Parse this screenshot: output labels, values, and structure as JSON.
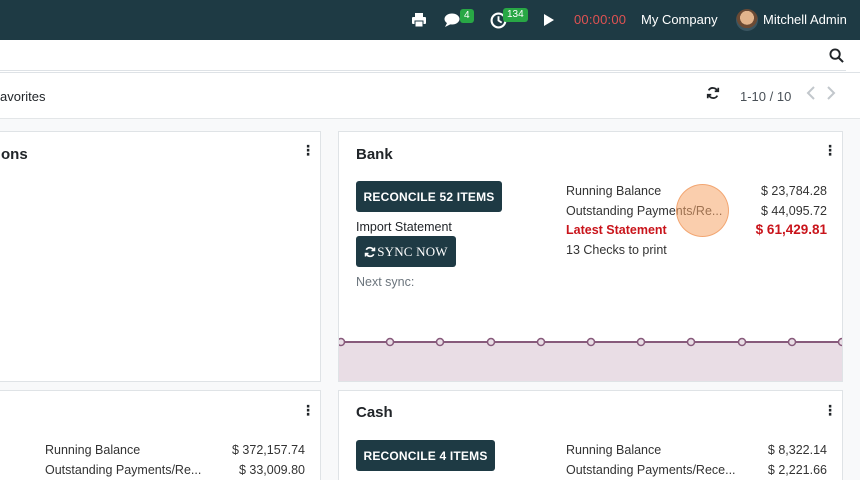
{
  "topnav": {
    "chat_badge": "4",
    "activity_badge": "134",
    "timer": "00:00:00",
    "company": "My Company",
    "user": "Mitchell Admin"
  },
  "control": {
    "favorites_label": "avorites",
    "pager": "1-10 / 10"
  },
  "cards": {
    "top_left": {
      "title": "ons"
    },
    "bank": {
      "title": "Bank",
      "reconcile_label": "RECONCILE 52 ITEMS",
      "import_label": "Import Statement",
      "sync_label": "SYNC NOW",
      "next_sync": "Next sync:",
      "running_balance_label": "Running Balance",
      "running_balance": "$ 23,784.28",
      "outstanding_label": "Outstanding Payments/Re...",
      "outstanding": "$ 44,095.72",
      "latest_label": "Latest Statement",
      "latest": "$ 61,429.81",
      "checks_label": "13 Checks to print"
    },
    "bottom_left": {
      "running_balance_label": "Running Balance",
      "running_balance": "$ 372,157.74",
      "outstanding_label": "Outstanding Payments/Re...",
      "outstanding": "$ 33,009.80"
    },
    "cash": {
      "title": "Cash",
      "reconcile_label": "RECONCILE 4 ITEMS",
      "running_balance_label": "Running Balance",
      "running_balance": "$ 8,322.14",
      "outstanding_label": "Outstanding Payments/Rece...",
      "outstanding": "$ 2,221.66"
    }
  },
  "colors": {
    "nav": "#1e3a44",
    "button": "#1e3a44",
    "latest": "#c9141b",
    "badge": "#28a745",
    "graph_line": "#875a7b",
    "graph_fill": "#e9dde5"
  },
  "icons": [
    "print-icon",
    "chat-icon",
    "clock-icon",
    "play-icon",
    "search-icon",
    "refresh-icon",
    "chevron-left-icon",
    "chevron-right-icon",
    "kebab-icon",
    "sync-icon"
  ]
}
